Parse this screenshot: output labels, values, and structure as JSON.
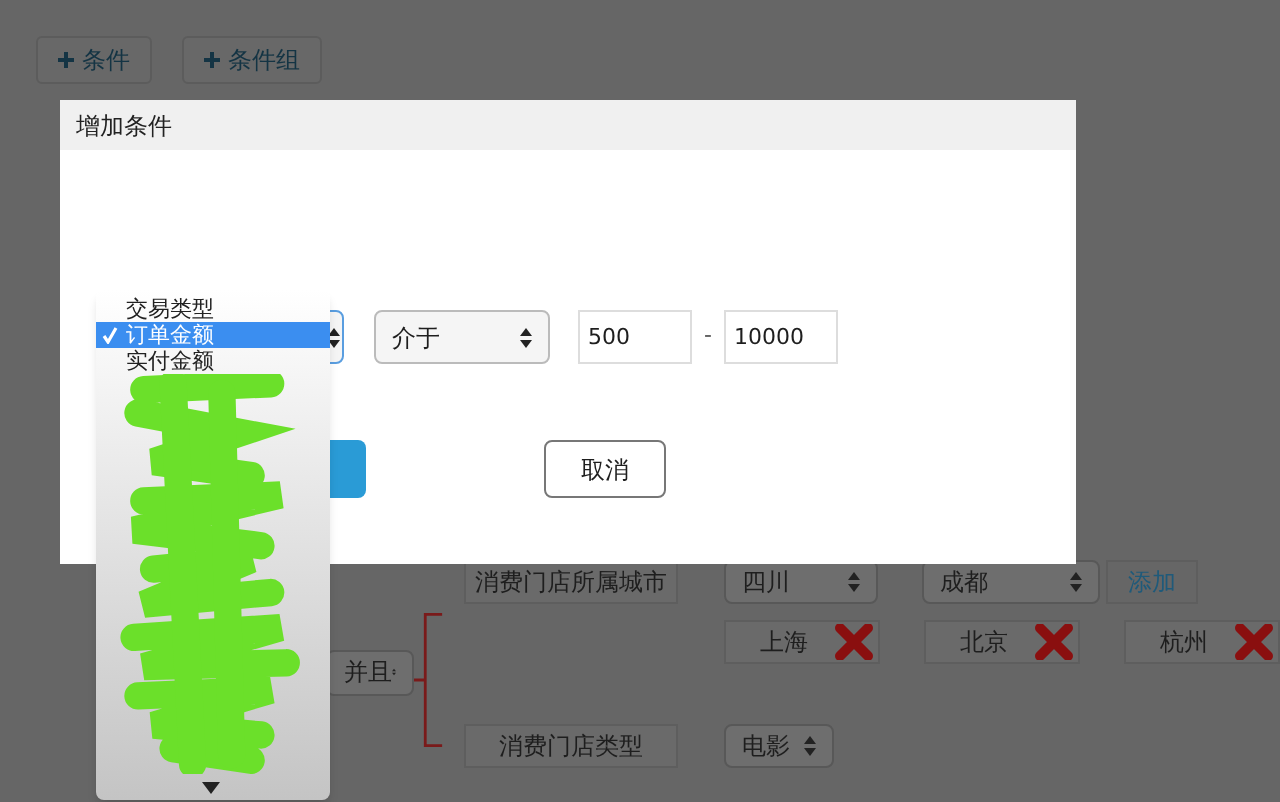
{
  "toolbar": {
    "buttons": [
      {
        "label": "条件"
      },
      {
        "label": "条件组"
      }
    ]
  },
  "conditions": {
    "logic": "并且",
    "rows": [
      {
        "kind": "city",
        "label": "消费门店所属城市",
        "province": "四川",
        "city": "成都",
        "action": "添加",
        "tags": [
          "上海",
          "北京",
          "杭州"
        ]
      },
      {
        "kind": "type",
        "label": "消费门店类型",
        "value": "电影"
      }
    ]
  },
  "dialog": {
    "title": "增加条件",
    "operator": "介于",
    "min": "500",
    "separator": "-",
    "max": "10000",
    "cancel": "取消",
    "field_options": [
      {
        "label": "交易类型",
        "selected": false
      },
      {
        "label": "订单金额",
        "selected": true
      },
      {
        "label": "实付金额",
        "selected": false
      }
    ]
  }
}
